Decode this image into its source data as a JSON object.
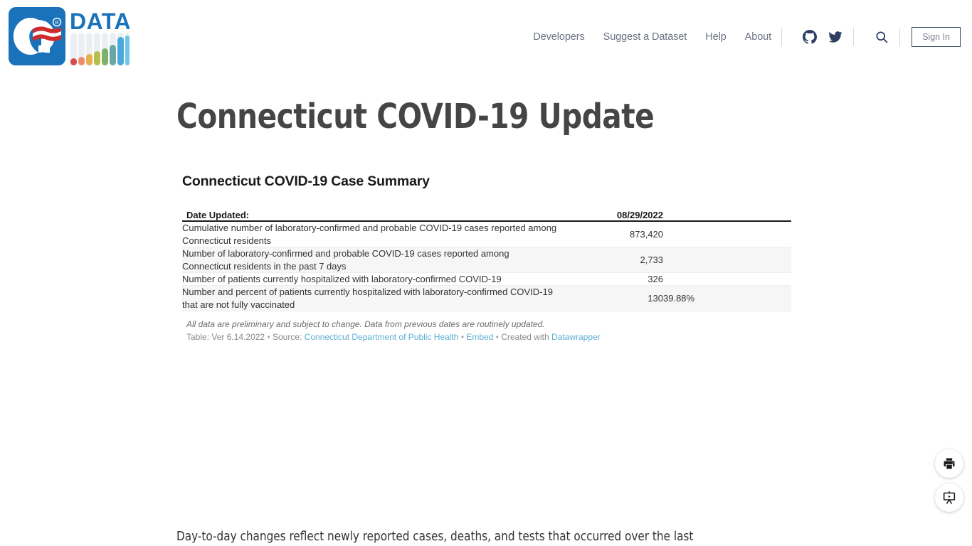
{
  "header": {
    "logo": {
      "mark_text": "Ct",
      "registered_mark": "®",
      "word_text": "DATA",
      "word_color": "#1a72ba",
      "mark_bg_color": "#1a72ba",
      "bar_colors": [
        "#d94a4a",
        "#ef8c6e",
        "#e8b04b",
        "#b5bf4c",
        "#7fb069",
        "#6aa6a6",
        "#4aa8dd",
        "#6ec6e8"
      ]
    },
    "nav_links": [
      {
        "label": "Developers",
        "name": "nav-link-developers"
      },
      {
        "label": "Suggest a Dataset",
        "name": "nav-link-suggest-a-dataset"
      },
      {
        "label": "Help",
        "name": "nav-link-help"
      },
      {
        "label": "About",
        "name": "nav-link-about"
      }
    ],
    "icons": [
      {
        "name": "github-icon",
        "label": "GitHub"
      },
      {
        "name": "twitter-icon",
        "label": "Twitter"
      },
      {
        "name": "search-icon",
        "label": "Search"
      }
    ],
    "sign_in_label": "Sign In",
    "icon_color": "#2d3e63"
  },
  "page": {
    "title": "Connecticut COVID-19 Update"
  },
  "table": {
    "title": "Connecticut COVID-19 Case Summary",
    "headers": {
      "label": "Date Updated:",
      "value": "08/29/2022",
      "pct": ""
    },
    "rows": [
      {
        "label": "Cumulative number of laboratory-confirmed and probable COVID-19 cases reported among Connecticut residents",
        "value": "873,420",
        "pct": ""
      },
      {
        "label": "Number of laboratory-confirmed and probable COVID-19 cases reported among Connecticut residents in the past 7 days",
        "value": "2,733",
        "pct": ""
      },
      {
        "label": "Number of patients currently hospitalized with laboratory-confirmed COVID-19",
        "value": "326",
        "pct": ""
      },
      {
        "label": "Number and percent of patients currently hospitalized with laboratory-confirmed COVID-19 that are not fully vaccinated",
        "value": "130",
        "pct": "39.88%"
      }
    ],
    "notes": {
      "disclaimer": "All data are preliminary and subject to change. Data from previous dates are routinely updated.",
      "credit_prefix": "Table: Ver 6.14.2022",
      "credit_source_label": "Source:",
      "credit_source_link": "Connecticut Department of Public Health",
      "credit_embed_link": "Embed",
      "credit_created_label": "Created with",
      "credit_tool_link": "Datawrapper",
      "separator": "•",
      "link_color": "#5aaed4"
    }
  },
  "body": {
    "paragraph": "Day-to-day changes reflect newly reported cases, deaths, and tests that occurred over the last"
  },
  "fabs": [
    {
      "name": "print-button",
      "label": "Print"
    },
    {
      "name": "presentation-button",
      "label": "Present"
    }
  ]
}
